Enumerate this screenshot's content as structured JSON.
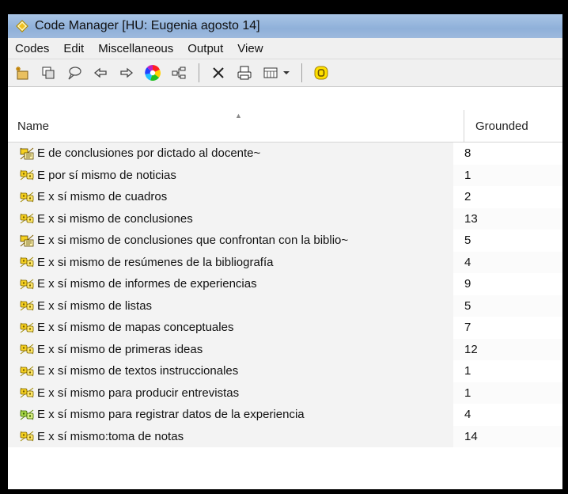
{
  "window": {
    "title": "Code Manager [HU: Eugenia agosto 14]",
    "title_icon": "diamond-app-icon"
  },
  "menubar": [
    "Codes",
    "Edit",
    "Miscellaneous",
    "Output",
    "View"
  ],
  "toolbar": {
    "buttons": [
      "new-code-icon",
      "copy-icon",
      "comment-icon",
      "back-arrow-icon",
      "forward-arrow-icon",
      "color-wheel-icon",
      "network-icon",
      "delete-icon",
      "print-icon",
      "list-view-icon",
      "dropdown-icon",
      "highlight-icon"
    ]
  },
  "table": {
    "columns": [
      "Name",
      "Grounded"
    ],
    "rows": [
      {
        "name": "E de conclusiones  por dictado al docente~",
        "grounded": "8",
        "icon": "code-comment-icon"
      },
      {
        "name": "E por sí mismo de noticias",
        "grounded": "1",
        "icon": "code-icon"
      },
      {
        "name": "E x  sí mismo de cuadros",
        "grounded": "2",
        "icon": "code-icon"
      },
      {
        "name": "E x si mismo de conclusiones",
        "grounded": "13",
        "icon": "code-icon"
      },
      {
        "name": "E x si mismo de conclusiones  que confrontan con la biblio~",
        "grounded": "5",
        "icon": "code-comment-icon"
      },
      {
        "name": "E x si mismo de resúmenes de la bibliografía",
        "grounded": "4",
        "icon": "code-icon"
      },
      {
        "name": "E x sí mismo de informes de experiencias",
        "grounded": "9",
        "icon": "code-icon"
      },
      {
        "name": "E x sí mismo de listas",
        "grounded": "5",
        "icon": "code-icon"
      },
      {
        "name": "E x sí mismo de mapas conceptuales",
        "grounded": "7",
        "icon": "code-icon"
      },
      {
        "name": "E x sí mismo de primeras ideas",
        "grounded": "12",
        "icon": "code-icon"
      },
      {
        "name": "E x sí mismo de textos instruccionales",
        "grounded": "1",
        "icon": "code-icon"
      },
      {
        "name": "E x sí mismo para producir entrevistas",
        "grounded": "1",
        "icon": "code-icon"
      },
      {
        "name": "E x sí mismo para registrar datos de la experiencia",
        "grounded": "4",
        "icon": "code-green-icon"
      },
      {
        "name": "E x sí mismo:toma de notas",
        "grounded": "14",
        "icon": "code-icon"
      }
    ]
  }
}
